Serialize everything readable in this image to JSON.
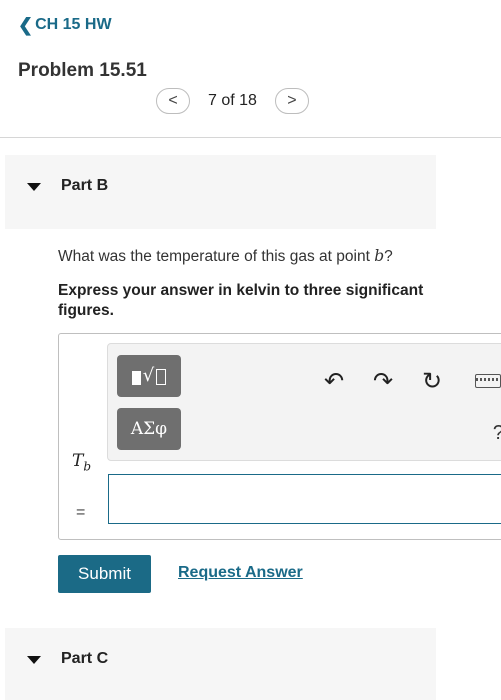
{
  "nav": {
    "back_label": "CH 15 HW"
  },
  "problem": {
    "title": "Problem 15.51"
  },
  "pager": {
    "position": "7 of 18",
    "prev_symbol": "<",
    "next_symbol": ">"
  },
  "parts": [
    {
      "label": "Part B"
    },
    {
      "label": "Part C"
    }
  ],
  "question": {
    "text_before": "What was the temperature of this gas at point ",
    "variable": "b",
    "text_after": "?",
    "instruction": "Express your answer in kelvin to three significant figures."
  },
  "toolbar": {
    "template_icon": "square-root-template-icon",
    "greek_label": "ΑΣφ",
    "undo_icon": "undo-icon",
    "redo_icon": "redo-icon",
    "reset_icon": "reset-icon",
    "keyboard_icon": "keyboard-icon",
    "help_label": "?"
  },
  "answer": {
    "variable": "T",
    "subscript": "b",
    "equals": "=",
    "value": ""
  },
  "actions": {
    "submit_label": "Submit",
    "request_label": "Request Answer"
  },
  "colors": {
    "accent": "#1b6a86",
    "tool_button": "#6f6f6f",
    "part_header_bg": "#f6f6f6"
  }
}
